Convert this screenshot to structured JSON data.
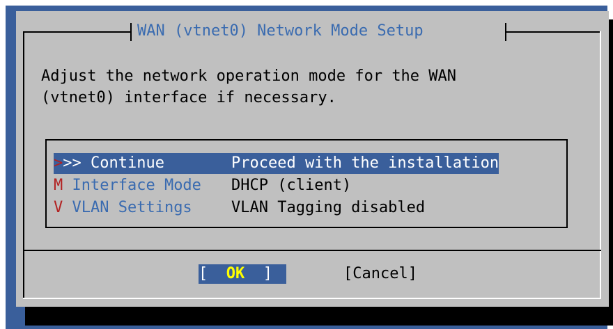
{
  "dialog": {
    "title": "WAN (vtnet0) Network Mode Setup",
    "message_line1": "Adjust the network operation mode for the WAN",
    "message_line2": "(vtnet0) interface if necessary."
  },
  "menu": {
    "items": [
      {
        "key": ">",
        "tag": ">> Continue",
        "description": "Proceed with the installation",
        "selected": true
      },
      {
        "key": "M",
        "tag": " Interface Mode",
        "description": "DHCP (client)",
        "selected": false
      },
      {
        "key": "V",
        "tag": " VLAN Settings",
        "description": "VLAN Tagging disabled",
        "selected": false
      }
    ]
  },
  "buttons": {
    "ok_open": "[  ",
    "ok_label": "OK",
    "ok_close": "  ]",
    "cancel_label": "[Cancel]"
  },
  "colors": {
    "background": "#3a5f9b",
    "dialog": "#c0c0c0",
    "title": "#3a6bb0",
    "hotkey": "#b22222",
    "highlight": "#3a5f9b",
    "ok_text": "#ffff00"
  }
}
